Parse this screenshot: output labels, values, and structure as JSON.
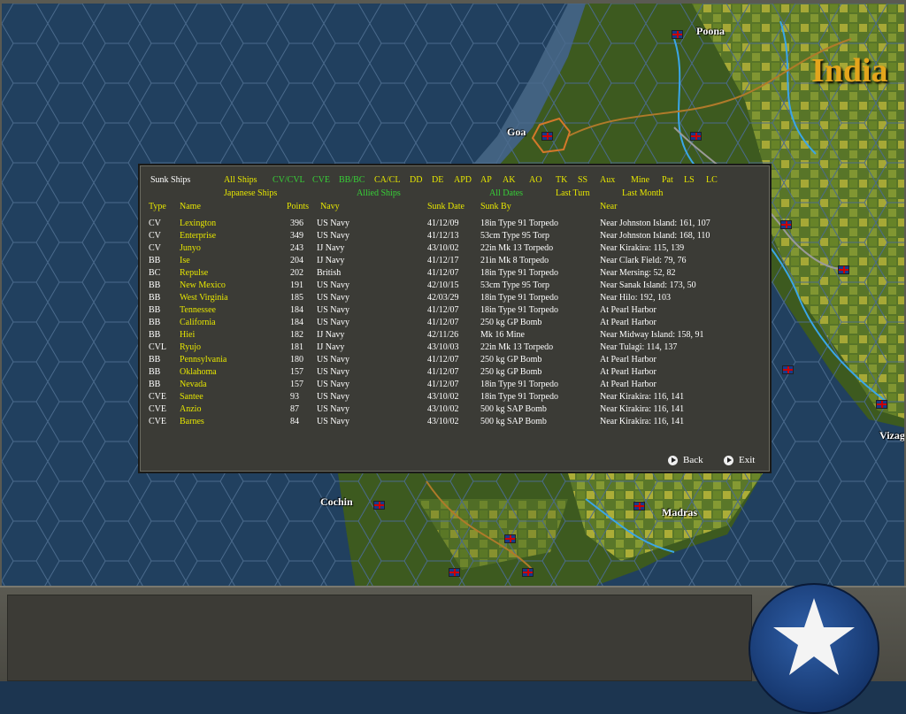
{
  "map": {
    "region_title": "India",
    "labels": [
      {
        "name": "poona",
        "text": "Poona"
      },
      {
        "name": "goa",
        "text": "Goa"
      },
      {
        "name": "cochin",
        "text": "Cochin"
      },
      {
        "name": "madras",
        "text": "Madras"
      },
      {
        "name": "vizag",
        "text": "Vizag"
      }
    ]
  },
  "dialog": {
    "title": "Sunk Ships",
    "filters_row1": [
      "All Ships",
      "CV/CVL",
      "CVE",
      "BB/BC",
      "CA/CL",
      "DD",
      "DE",
      "APD",
      "AP",
      "AK",
      "AO",
      "TK",
      "SS",
      "Aux",
      "Mine",
      "Pat",
      "LS",
      "LC"
    ],
    "filters_row2": [
      "Japanese Ships",
      "Allied Ships",
      "All Dates",
      "Last Turn",
      "Last Month"
    ],
    "columns": [
      "Type",
      "Name",
      "Points",
      "Navy",
      "Sunk Date",
      "Sunk By",
      "Near"
    ],
    "rows": [
      [
        "CV",
        "Lexington",
        "396",
        "US Navy",
        "41/12/09",
        "18in Type 91 Torpedo",
        "Near Johnston Island: 161, 107"
      ],
      [
        "CV",
        "Enterprise",
        "349",
        "US Navy",
        "41/12/13",
        "53cm Type 95 Torp",
        "Near Johnston Island: 168, 110"
      ],
      [
        "CV",
        "Junyo",
        "243",
        "IJ Navy",
        "43/10/02",
        "22in Mk 13 Torpedo",
        "Near Kirakira: 115, 139"
      ],
      [
        "BB",
        "Ise",
        "204",
        "IJ Navy",
        "41/12/17",
        "21in Mk 8 Torpedo",
        "Near Clark Field: 79, 76"
      ],
      [
        "BC",
        "Repulse",
        "202",
        "British",
        "41/12/07",
        "18in Type 91 Torpedo",
        "Near Mersing: 52, 82"
      ],
      [
        "BB",
        "New Mexico",
        "191",
        "US Navy",
        "42/10/15",
        "53cm Type 95 Torp",
        "Near Sanak Island: 173, 50"
      ],
      [
        "BB",
        "West Virginia",
        "185",
        "US Navy",
        "42/03/29",
        "18in Type 91 Torpedo",
        "Near Hilo: 192, 103"
      ],
      [
        "BB",
        "Tennessee",
        "184",
        "US Navy",
        "41/12/07",
        "18in Type 91 Torpedo",
        "At Pearl Harbor"
      ],
      [
        "BB",
        "California",
        "184",
        "US Navy",
        "41/12/07",
        "250 kg GP Bomb",
        "At Pearl Harbor"
      ],
      [
        "BB",
        "Hiei",
        "182",
        "IJ Navy",
        "42/11/26",
        "Mk 16 Mine",
        "Near Midway Island: 158, 91"
      ],
      [
        "CVL",
        "Ryujo",
        "181",
        "IJ Navy",
        "43/10/03",
        "22in Mk 13 Torpedo",
        "Near Tulagi: 114, 137"
      ],
      [
        "BB",
        "Pennsylvania",
        "180",
        "US Navy",
        "41/12/07",
        "250 kg GP Bomb",
        "At Pearl Harbor"
      ],
      [
        "BB",
        "Oklahoma",
        "157",
        "US Navy",
        "41/12/07",
        "250 kg GP Bomb",
        "At Pearl Harbor"
      ],
      [
        "BB",
        "Nevada",
        "157",
        "US Navy",
        "41/12/07",
        "18in Type 91 Torpedo",
        "At Pearl Harbor"
      ],
      [
        "CVE",
        "Santee",
        "93",
        "US Navy",
        "43/10/02",
        "18in Type 91 Torpedo",
        "Near Kirakira: 116, 141"
      ],
      [
        "CVE",
        "Anzio",
        "87",
        "US Navy",
        "43/10/02",
        "500 kg SAP Bomb",
        "Near Kirakira: 116, 141"
      ],
      [
        "CVE",
        "Barnes",
        "84",
        "US Navy",
        "43/10/02",
        "500 kg SAP Bomb",
        "Near Kirakira: 116, 141"
      ]
    ],
    "back_label": "Back",
    "exit_label": "Exit"
  },
  "icons": {
    "flag": "union-jack-flag-icon",
    "badge": "allied-star-badge-icon",
    "arrow": "arrow-right-icon"
  }
}
